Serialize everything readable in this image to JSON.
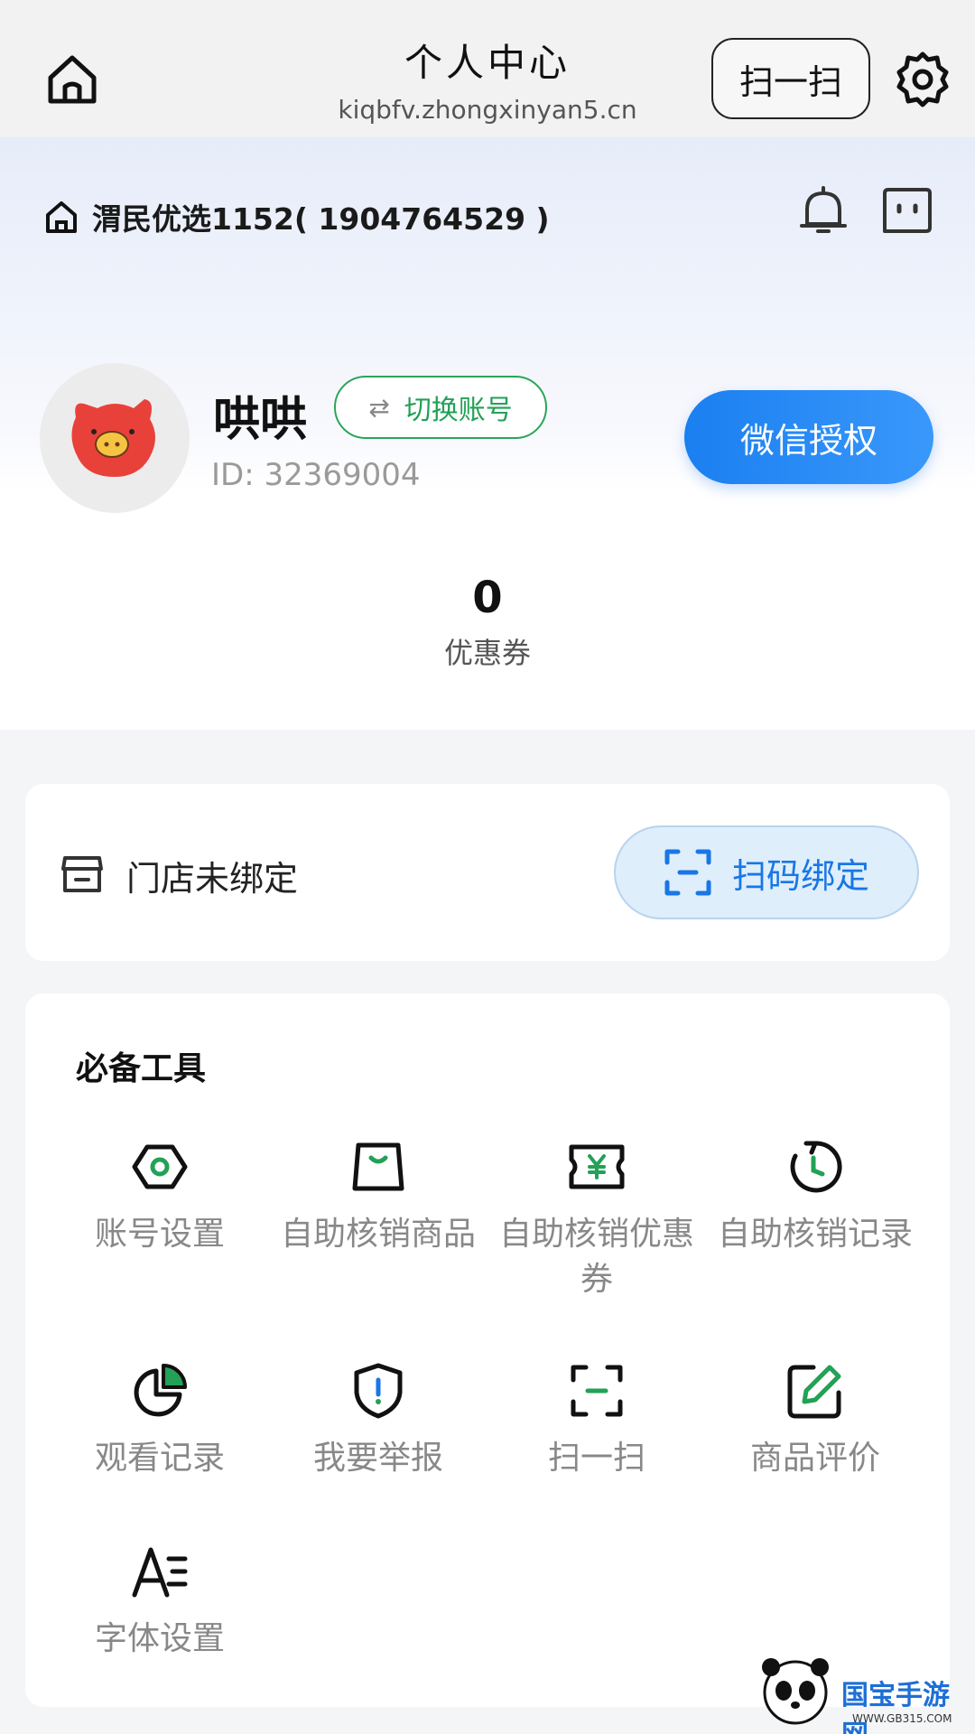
{
  "topbar": {
    "title": "个人中心",
    "url": "kiqbfv.zhongxinyan5.cn",
    "scan_label": "扫一扫"
  },
  "header": {
    "store_name": "渭民优选1152( 1904764529 )"
  },
  "profile": {
    "nickname": "哄哄",
    "switch_label": "切换账号",
    "id_text": "ID: 32369004",
    "wechat_auth_label": "微信授权"
  },
  "stats": {
    "coupon_count": "0",
    "coupon_label": "优惠券"
  },
  "store_bind": {
    "status_text": "门店未绑定",
    "button_label": "扫码绑定"
  },
  "tools": {
    "title": "必备工具",
    "items": [
      {
        "label": "账号设置",
        "icon": "hexagon-settings-icon"
      },
      {
        "label": "自助核销商品",
        "icon": "shopping-bag-icon"
      },
      {
        "label": "自助核销优惠券",
        "icon": "yen-ticket-icon"
      },
      {
        "label": "自助核销记录",
        "icon": "history-clock-icon"
      },
      {
        "label": "观看记录",
        "icon": "pie-chart-icon"
      },
      {
        "label": "我要举报",
        "icon": "shield-alert-icon"
      },
      {
        "label": "扫一扫",
        "icon": "scan-icon"
      },
      {
        "label": "商品评价",
        "icon": "edit-pen-icon"
      },
      {
        "label": "字体设置",
        "icon": "font-size-icon"
      }
    ]
  },
  "watermark": {
    "text": "国宝手游网",
    "sub": "WWW.GB315.COM"
  },
  "colors": {
    "accent_green": "#23a157",
    "accent_blue": "#1a7ff0"
  }
}
